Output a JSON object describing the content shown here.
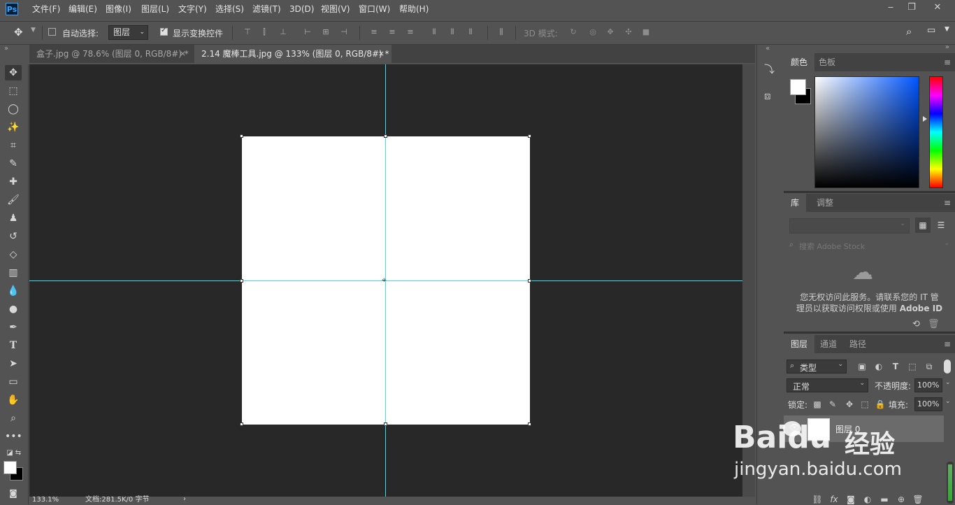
{
  "app": {
    "logo": "Ps",
    "menu": [
      "文件(F)",
      "编辑(E)",
      "图像(I)",
      "图层(L)",
      "文字(Y)",
      "选择(S)",
      "滤镜(T)",
      "3D(D)",
      "视图(V)",
      "窗口(W)",
      "帮助(H)"
    ],
    "window_controls": [
      "minimize",
      "restore",
      "close"
    ]
  },
  "options": {
    "auto_select_label": "自动选择:",
    "auto_select_checked": false,
    "target_value": "图层",
    "show_transform_label": "显示变换控件",
    "show_transform_checked": true,
    "mode_3d_label": "3D 模式:"
  },
  "tabs": [
    {
      "label": "盒子.jpg @ 78.6% (图层 0, RGB/8#) *",
      "active": false
    },
    {
      "label": "2.14 魔棒工具.jpg @ 133% (图层 0, RGB/8#) *",
      "active": true
    }
  ],
  "tab_close": "×",
  "status": {
    "zoom": "133.1%",
    "doc_info": "文档:281.5K/0 字节"
  },
  "color_panel": {
    "tabs": [
      "颜色",
      "色板"
    ],
    "foreground": "#ffffff",
    "background": "#000000"
  },
  "library_panel": {
    "tabs": [
      "库",
      "调整"
    ],
    "search_placeholder": "搜索 Adobe Stock",
    "message_line1": "您无权访问此服务。请联系您的 IT 管",
    "message_line2": "理员以获取访问权限或使用",
    "message_link": "Adobe ID"
  },
  "layers_panel": {
    "tabs": [
      "图层",
      "通道",
      "路径"
    ],
    "filter_label": "类型",
    "blend_mode": "正常",
    "opacity_label": "不透明度:",
    "opacity_value": "100%",
    "lock_label": "锁定:",
    "fill_label": "填充:",
    "fill_value": "100%",
    "layers": [
      {
        "name": "图层 0",
        "visible": true
      }
    ]
  },
  "watermark": {
    "brand": "Baidu",
    "cn": "经验",
    "url": "jingyan.baidu.com"
  },
  "colors": {
    "guide": "#37e1f0",
    "canvas_bg": "#282828",
    "doc_bg": "#ffffff",
    "ui_bg": "#535353"
  }
}
